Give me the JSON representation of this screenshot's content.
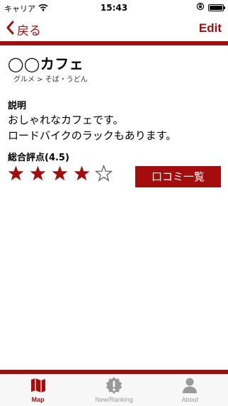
{
  "status_bar": {
    "carrier": "キャリア",
    "time": "15:43"
  },
  "nav": {
    "back_label": "戻る",
    "edit_label": "Edit"
  },
  "shop": {
    "name": "◯◯カフェ",
    "category": "グルメ > そば・うどん",
    "description_heading": "説明",
    "description_lines": [
      "おしゃれなカフェです。",
      "ロードバイクのラックもあります。"
    ],
    "rating_label": "総合評点(4.5)",
    "rating_stars": 4,
    "rating_max": 5,
    "reviews_button": "口コミ一覧"
  },
  "tabs": [
    {
      "label": "Map",
      "icon": "map-icon",
      "active": true
    },
    {
      "label": "New/Ranking",
      "icon": "alert-badge-icon",
      "active": false
    },
    {
      "label": "About",
      "icon": "person-icon",
      "active": false
    }
  ],
  "colors": {
    "accent": "#a50d0d",
    "inactive": "#9a9a9a",
    "tab_bar_bg": "#f7f7f7"
  }
}
